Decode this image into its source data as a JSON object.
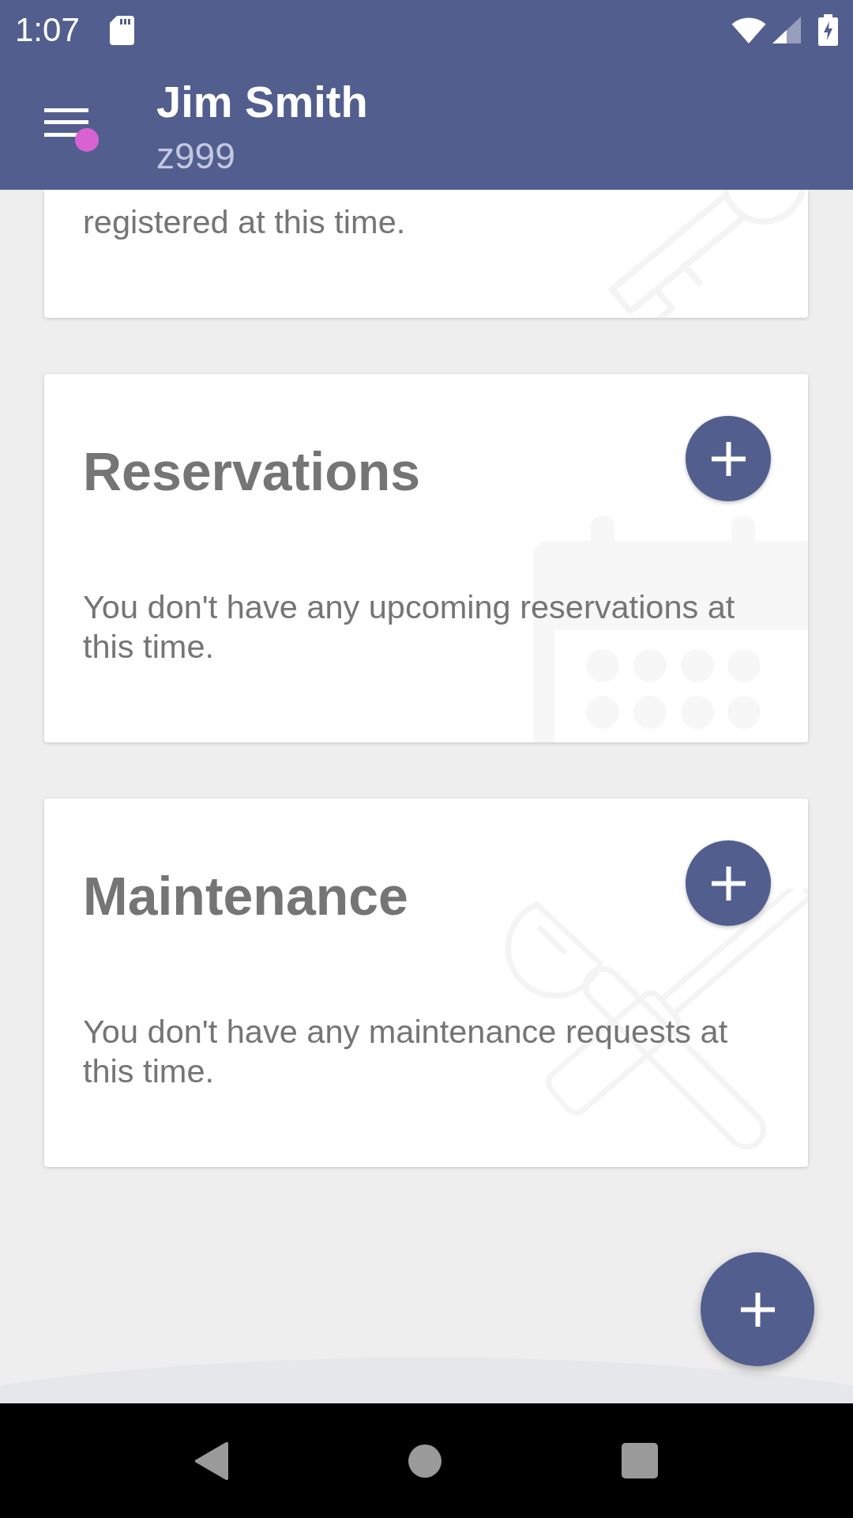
{
  "status_bar": {
    "time": "1:07"
  },
  "app_bar": {
    "title": "Jim Smith",
    "subtitle": "z999",
    "menu_badge": true
  },
  "cards": [
    {
      "message": "registered at this time."
    },
    {
      "title": "Reservations",
      "message": "You don't have any upcoming reservations at this time."
    },
    {
      "title": "Maintenance",
      "message": "You don't have any maintenance requests at this time."
    }
  ]
}
